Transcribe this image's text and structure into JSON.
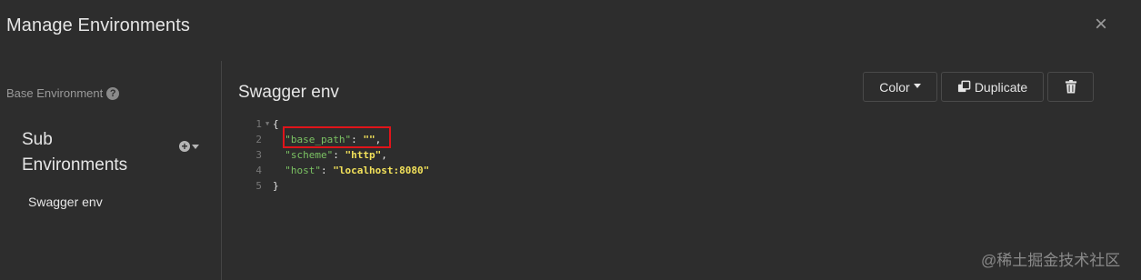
{
  "modal": {
    "title": "Manage Environments",
    "close_glyph": "×"
  },
  "sidebar": {
    "base_environment_label": "Base Environment",
    "help_glyph": "?",
    "sub_environments_title": "Sub Environments",
    "add_glyph": "+",
    "environments": [
      {
        "name": "Swagger env"
      }
    ]
  },
  "editor_panel": {
    "environment_name": "Swagger env",
    "buttons": {
      "color_label": "Color",
      "duplicate_label": "Duplicate"
    },
    "code_lines": [
      {
        "num": "1",
        "open": "{"
      },
      {
        "num": "2",
        "key": "\"base_path\"",
        "value": "\"\"",
        "trail": ","
      },
      {
        "num": "3",
        "key": "\"scheme\"",
        "value": "\"http\"",
        "trail": ","
      },
      {
        "num": "4",
        "key": "\"host\"",
        "value": "\"localhost:8080\"",
        "trail": ""
      },
      {
        "num": "5",
        "close": "}"
      }
    ]
  },
  "watermark": "@稀土掘金技术社区",
  "colors": {
    "background": "#2d2d2d",
    "json_key": "#7bc263",
    "json_string": "#f2e15a",
    "highlight": "#e0141a"
  },
  "icons": {
    "close": "close-icon",
    "help": "help-circle-icon",
    "add": "plus-circle-icon",
    "dropdown": "caret-down-icon",
    "duplicate": "duplicate-icon",
    "delete": "trash-icon"
  }
}
